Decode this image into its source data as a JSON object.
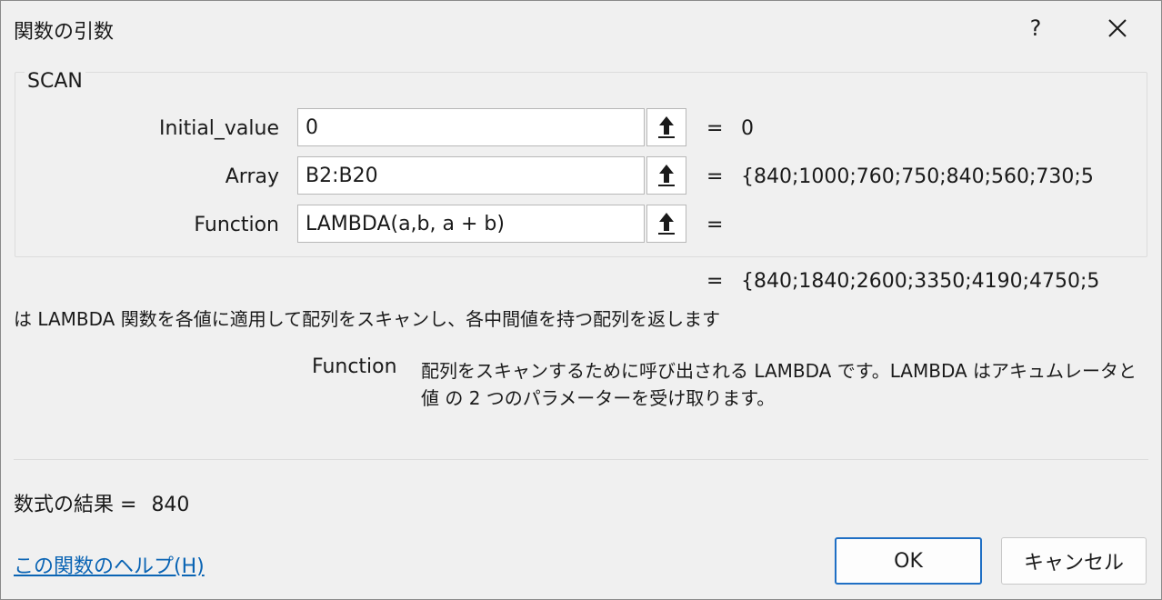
{
  "dialog": {
    "title": "関数の引数",
    "help_glyph": "?",
    "close_icon": "close-icon"
  },
  "function_group": {
    "name": "SCAN",
    "arguments": [
      {
        "label": "Initial_value",
        "value": "0",
        "eq": "=",
        "evaluated": "0"
      },
      {
        "label": "Array",
        "value": "B2:B20",
        "eq": "=",
        "evaluated": "{840;1000;760;750;840;560;730;5"
      },
      {
        "label": "Function",
        "value": "LAMBDA(a,b, a + b)",
        "eq": "=",
        "evaluated": ""
      }
    ]
  },
  "result_preview": {
    "eq": "=",
    "value": "{840;1840;2600;3350;4190;4750;5"
  },
  "description": "は LAMBDA 関数を各値に適用して配列をスキャンし、各中間値を持つ配列を返します",
  "argument_help": {
    "name": "Function",
    "text": "配列をスキャンするために呼び出される LAMBDA です。LAMBDA はアキュムレータと値 の 2 つのパラメーターを受け取ります。"
  },
  "formula_result": {
    "label": "数式の結果 =",
    "value": "840"
  },
  "help_link": "この関数のヘルプ(H)",
  "buttons": {
    "ok": "OK",
    "cancel": "キャンセル"
  },
  "colors": {
    "accent": "#1f6fc4",
    "link": "#0a64b4",
    "background": "#f0f0f0"
  }
}
